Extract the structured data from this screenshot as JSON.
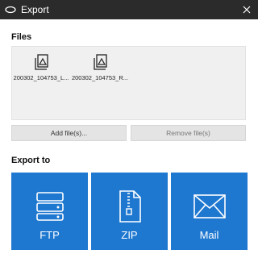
{
  "window": {
    "title": "Export"
  },
  "files_section": {
    "label": "Files",
    "items": [
      {
        "name": "200302_104753_L...",
        "icon": "image-file-icon"
      },
      {
        "name": "200302_104753_R...",
        "icon": "image-file-icon"
      }
    ],
    "add_label": "Add file(s)...",
    "remove_label": "Remove file(s)"
  },
  "export_section": {
    "label": "Export to",
    "targets": [
      {
        "label": "FTP",
        "icon": "server-drive-icon"
      },
      {
        "label": "ZIP",
        "icon": "zip-file-icon"
      },
      {
        "label": "Mail",
        "icon": "envelope-icon"
      }
    ]
  },
  "colors": {
    "titlebar": "#2b2b2b",
    "tile": "#1f78d0",
    "panel": "#f0f0f0"
  }
}
